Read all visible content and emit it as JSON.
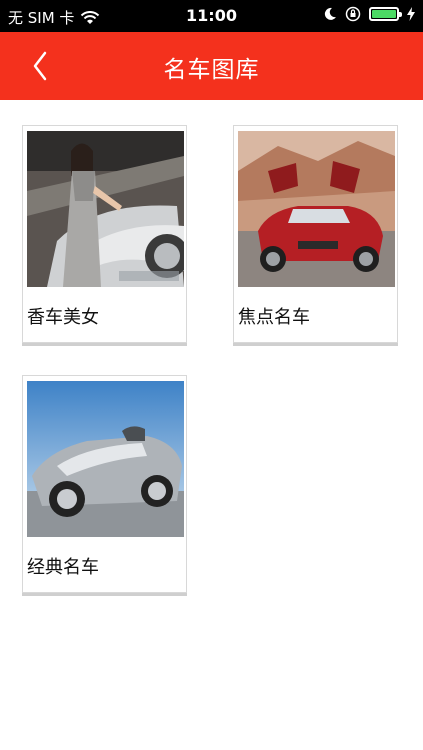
{
  "status_bar": {
    "carrier": "无 SIM 卡",
    "time": "11:00",
    "icons": [
      "wifi-icon",
      "moon-icon",
      "orientation-lock-icon",
      "battery-icon",
      "charging-icon"
    ]
  },
  "nav": {
    "title": "名车图库",
    "back_icon": "chevron-left-icon",
    "background": "#f4311d"
  },
  "gallery": [
    {
      "label": "香车美女",
      "image": "car-model-photo"
    },
    {
      "label": "焦点名车",
      "image": "red-gullwing-car-photo"
    },
    {
      "label": "经典名车",
      "image": "silver-roadster-photo"
    }
  ]
}
